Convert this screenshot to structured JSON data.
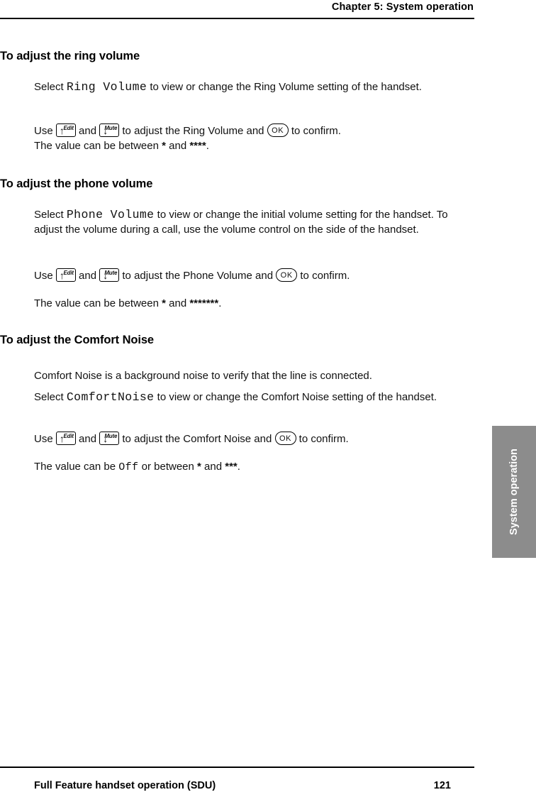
{
  "header": {
    "chapter": "Chapter 5:  System operation"
  },
  "footer": {
    "title": "Full Feature handset operation (SDU)",
    "page": "121"
  },
  "sidetab": {
    "label": "System operation"
  },
  "sections": [
    {
      "heading": "To adjust the ring volume",
      "paragraphs": [
        {
          "id": "ring-select",
          "parts": [
            {
              "t": "text",
              "v": "Select "
            },
            {
              "t": "mono",
              "v": "Ring Volume"
            },
            {
              "t": "text",
              "v": " to view or change the Ring Volume setting of the handset."
            }
          ]
        },
        {
          "id": "ring-use",
          "parts": [
            {
              "t": "text",
              "v": "Use "
            },
            {
              "t": "key-up",
              "v": "Edit"
            },
            {
              "t": "text",
              "v": " and "
            },
            {
              "t": "key-down",
              "v": "Mute"
            },
            {
              "t": "text",
              "v": " to adjust the Ring Volume and "
            },
            {
              "t": "key-ok",
              "v": "OK"
            },
            {
              "t": "text",
              "v": " to confirm."
            }
          ]
        },
        {
          "id": "ring-value",
          "parts": [
            {
              "t": "text",
              "v": "The value can be between "
            },
            {
              "t": "bold",
              "v": "*"
            },
            {
              "t": "text",
              "v": " and "
            },
            {
              "t": "bold",
              "v": "****"
            },
            {
              "t": "text",
              "v": "."
            }
          ]
        }
      ]
    },
    {
      "heading": "To adjust the phone volume",
      "paragraphs": [
        {
          "id": "phone-select",
          "parts": [
            {
              "t": "text",
              "v": "Select "
            },
            {
              "t": "mono",
              "v": "Phone Volume"
            },
            {
              "t": "text",
              "v": " to view or change the initial volume setting for the handset. To adjust the volume during a call, use the volume control on the side of the handset."
            }
          ]
        },
        {
          "id": "phone-use",
          "parts": [
            {
              "t": "text",
              "v": "Use "
            },
            {
              "t": "key-up",
              "v": "Edit"
            },
            {
              "t": "text",
              "v": " and "
            },
            {
              "t": "key-down",
              "v": "Mute"
            },
            {
              "t": "text",
              "v": "  to adjust the Phone Volume and "
            },
            {
              "t": "key-ok",
              "v": "OK"
            },
            {
              "t": "text",
              "v": " to confirm."
            }
          ]
        },
        {
          "id": "phone-value",
          "parts": [
            {
              "t": "text",
              "v": "The value can be between "
            },
            {
              "t": "bold",
              "v": "*"
            },
            {
              "t": "text",
              "v": " and "
            },
            {
              "t": "bold",
              "v": "*******"
            },
            {
              "t": "text",
              "v": "."
            }
          ]
        }
      ]
    },
    {
      "heading": "To adjust the Comfort Noise",
      "paragraphs": [
        {
          "id": "comfort-intro",
          "parts": [
            {
              "t": "text",
              "v": "Comfort Noise is a background noise to verify that the line is connected."
            }
          ]
        },
        {
          "id": "comfort-select",
          "parts": [
            {
              "t": "text",
              "v": "Select "
            },
            {
              "t": "mono",
              "v": "ComfortNoise"
            },
            {
              "t": "text",
              "v": " to view or change the Comfort Noise setting of the handset."
            }
          ]
        },
        {
          "id": "comfort-use",
          "parts": [
            {
              "t": "text",
              "v": "Use "
            },
            {
              "t": "key-up",
              "v": "Edit"
            },
            {
              "t": "text",
              "v": " and "
            },
            {
              "t": "key-down",
              "v": "Mute"
            },
            {
              "t": "text",
              "v": " to adjust the Comfort Noise and "
            },
            {
              "t": "key-ok",
              "v": "OK"
            },
            {
              "t": "text",
              "v": " to confirm."
            }
          ]
        },
        {
          "id": "comfort-value",
          "parts": [
            {
              "t": "text",
              "v": "The value can be "
            },
            {
              "t": "mono-small",
              "v": "Off"
            },
            {
              "t": "text",
              "v": " or between "
            },
            {
              "t": "bold",
              "v": "*"
            },
            {
              "t": "text",
              "v": " and "
            },
            {
              "t": "bold",
              "v": "***"
            },
            {
              "t": "text",
              "v": "."
            }
          ]
        }
      ]
    }
  ],
  "icons": {
    "up_arrow": "↑",
    "down_arrow": "↓"
  },
  "layout": {
    "positions": {
      "ring-heading": 70,
      "ring-select": 112,
      "ring-use": 174,
      "ring-value": 195,
      "phone-heading": 250,
      "phone-select": 292,
      "phone-use": 378,
      "phone-value": 417,
      "comfort-heading": 470,
      "comfort-intro": 519,
      "comfort-select": 549,
      "comfort-use": 608,
      "comfort-value": 647
    }
  }
}
